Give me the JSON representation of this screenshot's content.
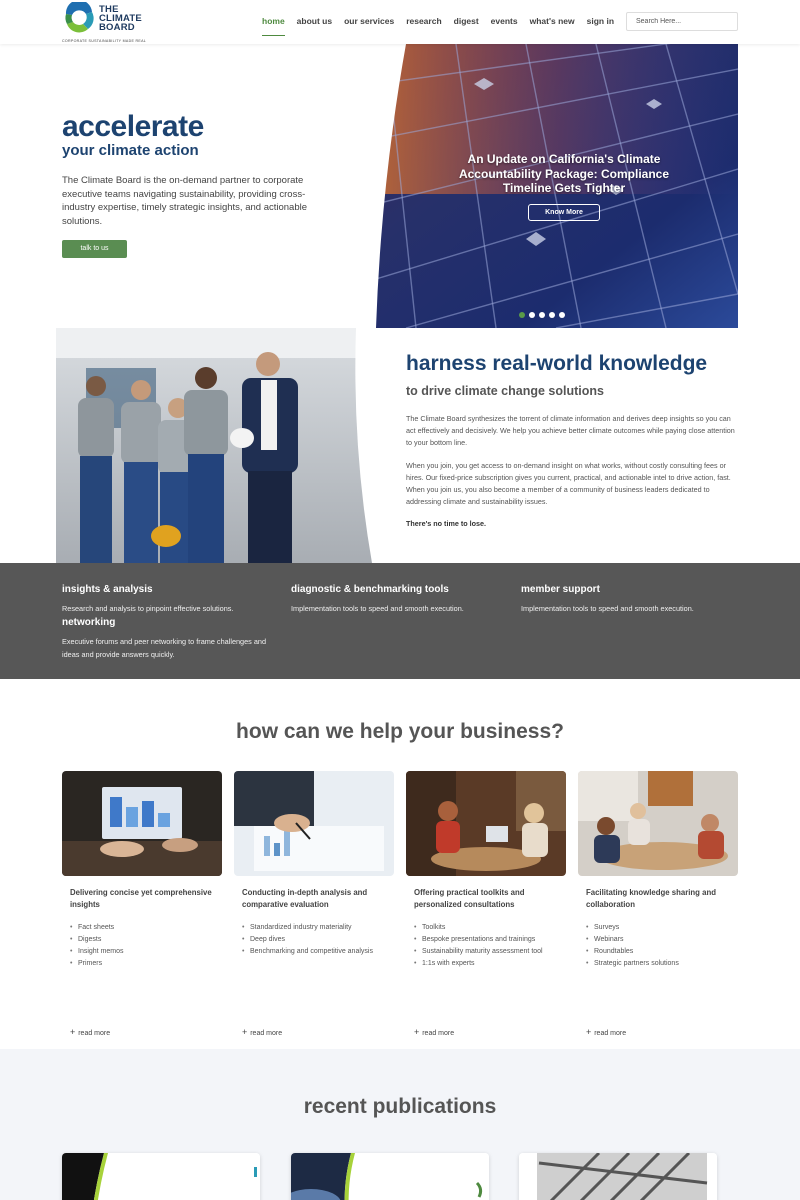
{
  "brand": {
    "name_line1": "THE",
    "name_line2": "CLIMATE",
    "name_line3": "BOARD",
    "tagline": "CORPORATE SUSTAINABILITY MADE REAL",
    "accent": "#4e8a3f",
    "navy": "#1d4370"
  },
  "nav": {
    "items": [
      {
        "label": "home",
        "active": true
      },
      {
        "label": "about us",
        "active": false
      },
      {
        "label": "our services",
        "active": false
      },
      {
        "label": "research",
        "active": false
      },
      {
        "label": "digest",
        "active": false
      },
      {
        "label": "events",
        "active": false
      },
      {
        "label": "what's new",
        "active": false
      },
      {
        "label": "sign in",
        "active": false
      }
    ],
    "search_placeholder": "Search Here..."
  },
  "hero": {
    "title": "accelerate",
    "subtitle": "your climate action",
    "body": "The Climate Board is the on-demand partner to corporate executive teams navigating sustainability, providing cross-industry expertise, timely strategic insights, and actionable solutions.",
    "cta": "talk to us",
    "slide": {
      "caption": "An Update on California's Climate Accountability Package: Compliance Timeline Gets Tighter",
      "button": "Know More",
      "dot_count": 5,
      "active_dot": 1
    }
  },
  "knowledge": {
    "title": "harness real-world knowledge",
    "subtitle": "to drive climate change solutions",
    "p1": "The Climate Board synthesizes the torrent of climate information and derives deep insights so you can act effectively and decisively. We help you achieve better climate outcomes while paying close attention to your bottom line.",
    "p2": "When you join, you get access to on-demand insight on what works, without costly consulting fees or hires. Our fixed-price subscription gives you current, practical, and actionable intel to drive action, fast. When you join us, you also become a member of a community of business leaders dedicated to addressing climate and sustainability issues.",
    "p3": "There's no time to lose."
  },
  "features": [
    {
      "title": "insights & analysis",
      "desc": "Research and analysis to pinpoint effective solutions."
    },
    {
      "title": "diagnostic & benchmarking tools",
      "desc": "Implementation tools to speed and smooth execution."
    },
    {
      "title": "member support",
      "desc": "Implementation tools to speed and smooth execution."
    },
    {
      "title": "networking",
      "desc": "Executive forums and peer networking to frame challenges and ideas and provide answers quickly."
    }
  ],
  "help": {
    "title": "how can we help your business?",
    "read_more": "read more",
    "cards": [
      {
        "title": "Delivering concise yet comprehensive insights",
        "items": [
          "Fact sheets",
          "Digests",
          "Insight memos",
          "Primers"
        ]
      },
      {
        "title": "Conducting in-depth analysis and comparative evaluation",
        "items": [
          "Standardized industry materiality",
          "Deep dives",
          "Benchmarking and competitive analysis"
        ]
      },
      {
        "title": "Offering practical toolkits and personalized consultations",
        "items": [
          "Toolkits",
          "Bespoke presentations and trainings",
          "Sustainability maturity assessment tool",
          "1:1s with experts"
        ]
      },
      {
        "title": "Facilitating knowledge sharing and collaboration",
        "items": [
          "Surveys",
          "Webinars",
          "Roundtables",
          "Strategic partners solutions"
        ]
      }
    ]
  },
  "publications": {
    "title": "recent publications"
  }
}
